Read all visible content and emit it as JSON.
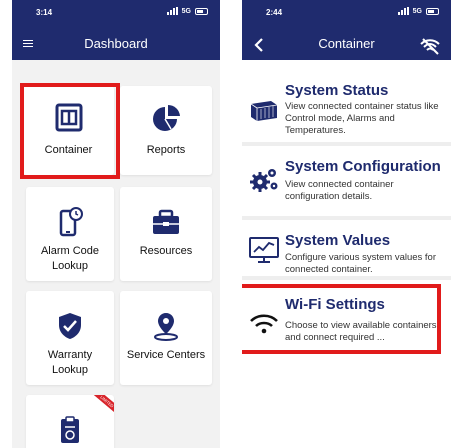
{
  "left_screen": {
    "status": {
      "time": "3:14",
      "network": "5G"
    },
    "header": {
      "title": "Dashboard"
    },
    "tiles": [
      {
        "id": "container",
        "label": "Container",
        "icon": "container-icon"
      },
      {
        "id": "reports",
        "label": "Reports",
        "icon": "pie-chart-icon"
      },
      {
        "id": "alarm",
        "label": "Alarm Code Lookup",
        "label_line1": "Alarm Code",
        "label_line2": "Lookup",
        "icon": "phone-clock-icon"
      },
      {
        "id": "resources",
        "label": "Resources",
        "icon": "toolbox-icon"
      },
      {
        "id": "warranty",
        "label": "Warranty Lookup",
        "label_line1": "Warranty",
        "label_line2": "Lookup",
        "icon": "shield-check-icon"
      },
      {
        "id": "service",
        "label": "Service Centers",
        "icon": "map-pin-icon"
      },
      {
        "id": "clipboard",
        "label": "",
        "icon": "clipboard-icon",
        "ribbon": "LIMITED"
      }
    ]
  },
  "right_screen": {
    "status": {
      "time": "2:44",
      "network": "5G"
    },
    "header": {
      "title": "Container"
    },
    "cards": [
      {
        "title": "System Status",
        "desc": "View connected container status like Control mode, Alarms and Temperatures.",
        "icon": "container-3d-icon"
      },
      {
        "title": "System Configuration",
        "desc": "View connected container configuration details.",
        "icon": "gears-icon"
      },
      {
        "title": "System Values",
        "desc": "Configure various system values for connected container.",
        "icon": "monitor-chart-icon"
      },
      {
        "title": "Wi-Fi Settings",
        "desc": "Choose to view available containers and connect required ...",
        "icon": "wifi-icon"
      }
    ]
  },
  "colors": {
    "navy": "#1f2b6e",
    "highlight": "#e11b1b"
  }
}
